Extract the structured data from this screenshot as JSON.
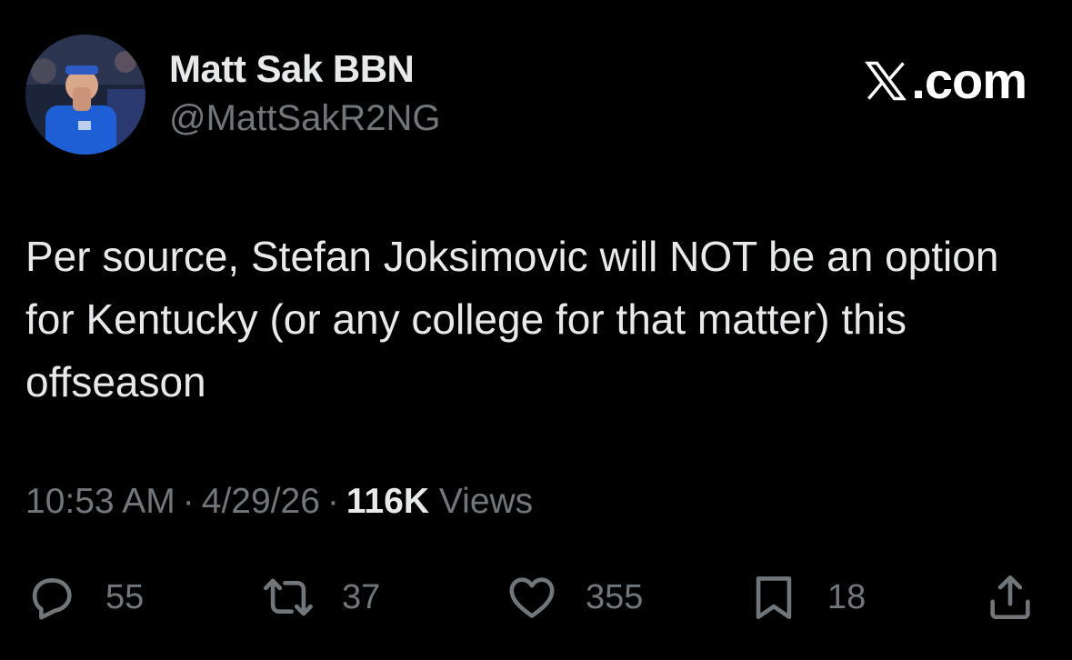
{
  "author": {
    "name": "Matt Sak BBN",
    "handle": "@MattSakR2NG"
  },
  "brand": {
    "label": ".com",
    "icon": "x-logo-icon"
  },
  "tweet": {
    "text": "Per source, Stefan Joksimovic will NOT be an option for Kentucky (or any college for that matter) this offseason"
  },
  "meta": {
    "time": "10:53 AM",
    "separator": "·",
    "date": "4/29/26",
    "views_count": "116K",
    "views_label": "Views"
  },
  "actions": {
    "reply": {
      "icon": "reply-icon",
      "count": "55"
    },
    "repost": {
      "icon": "repost-icon",
      "count": "37"
    },
    "like": {
      "icon": "heart-icon",
      "count": "355"
    },
    "bookmark": {
      "icon": "bookmark-icon",
      "count": "18"
    },
    "share": {
      "icon": "share-icon"
    }
  },
  "colors": {
    "background": "#000000",
    "primary_text": "#e7e9ea",
    "secondary_text": "#71767b"
  }
}
